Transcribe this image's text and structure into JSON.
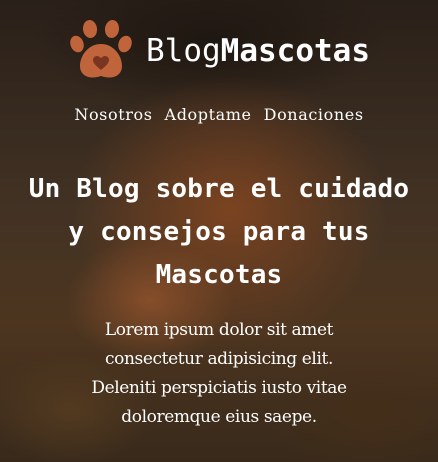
{
  "logo": {
    "icon": "paw-heart-icon",
    "brand_light": "Blog",
    "brand_bold": "Mascotas",
    "accent_color": "#c0643c"
  },
  "nav": {
    "items": [
      {
        "label": "Nosotros"
      },
      {
        "label": "Adoptame"
      },
      {
        "label": "Donaciones"
      }
    ]
  },
  "hero": {
    "title_lines": [
      "Un Blog sobre el cuidado",
      "y consejos para tus",
      "Mascotas"
    ],
    "description_lines": [
      "Lorem ipsum dolor sit amet",
      "consectetur adipisicing elit.",
      "Deleniti perspiciatis iusto vitae",
      "doloremque eius saepe."
    ]
  }
}
